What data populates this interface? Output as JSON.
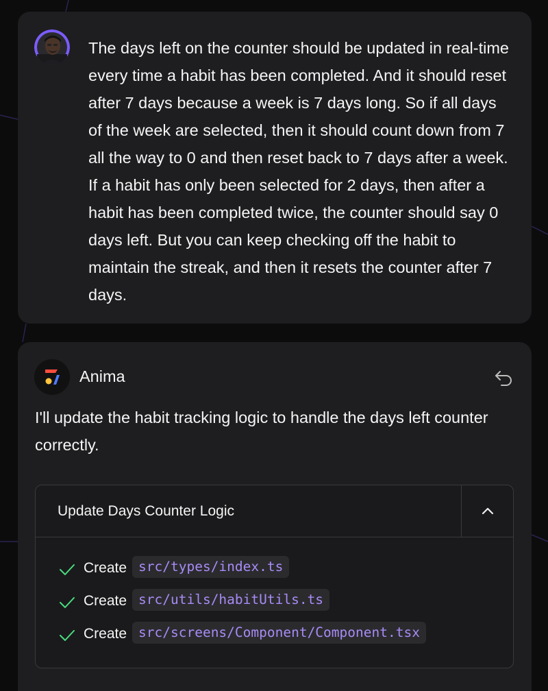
{
  "user_message": {
    "text": "The days left on the counter should be updated in real-time every time a habit has been completed. And it should reset after 7 days because a week is 7 days long. So if all days of the week are selected, then it should count down from 7 all the way to 0 and then reset back to 7 days after a week. If a habit has only been selected for 2 days, then after a habit has been completed twice, the counter should say 0 days left. But you can keep checking off the habit to maintain the streak, and then it resets the counter after 7 days."
  },
  "assistant_message": {
    "name": "Anima",
    "text": "I'll update the habit tracking logic to handle the days left counter correctly.",
    "undo_icon": "undo-icon",
    "task": {
      "title": "Update Days Counter Logic",
      "collapse_icon": "chevron-up-icon",
      "items": [
        {
          "verb": "Create",
          "path": "src/types/index.ts",
          "status": "done"
        },
        {
          "verb": "Create",
          "path": "src/utils/habitUtils.ts",
          "status": "done"
        },
        {
          "verb": "Create",
          "path": "src/screens/Component/Component.tsx",
          "status": "done"
        }
      ]
    }
  },
  "colors": {
    "background": "#0c0c0d",
    "card": "#1e1e20",
    "check": "#4ade80",
    "code_text": "#a88bf5",
    "code_bg": "#2b2b2e",
    "avatar_ring": "#7c5cff"
  }
}
